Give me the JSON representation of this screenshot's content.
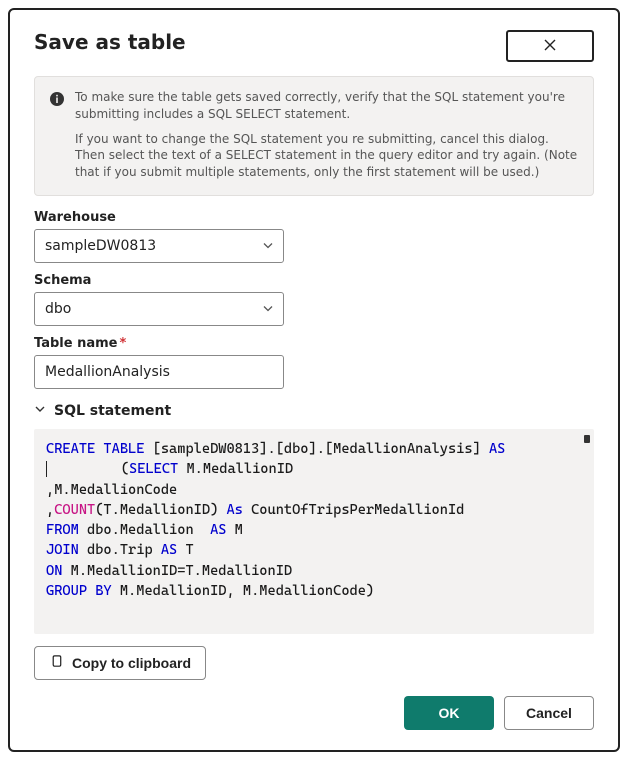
{
  "dialog": {
    "title": "Save as table",
    "info_line1": "To make sure the table gets saved correctly, verify that the SQL statement you're submitting includes a SQL SELECT statement.",
    "info_line2": "If you want to change the SQL statement you re submitting, cancel this dialog. Then select the text of a SELECT statement in the query editor and try again. (Note that if you submit multiple statements, only the first statement will be used.)"
  },
  "fields": {
    "warehouse_label": "Warehouse",
    "warehouse_value": "sampleDW0813",
    "schema_label": "Schema",
    "schema_value": "dbo",
    "tablename_label": "Table name",
    "tablename_value": "MedallionAnalysis"
  },
  "sql": {
    "header": "SQL statement",
    "tokens": {
      "create_table": "CREATE TABLE",
      "target": " [sampleDW0813].[dbo].[MedallionAnalysis] ",
      "as1": "AS",
      "indent_open": "         (",
      "select": "SELECT",
      "sel_col1": " M.MedallionID",
      "line2": ",M.MedallionCode",
      "comma3": ",",
      "count": "COUNT",
      "count_arg": "(T.MedallionID) ",
      "as2": "As",
      "alias": " CountOfTripsPerMedallionId",
      "from": "FROM",
      "from_body": " dbo.Medallion  ",
      "as3": "AS",
      "m": " M",
      "join": "JOIN",
      "join_body": " dbo.Trip ",
      "as4": "AS",
      "t": " T",
      "on": "ON",
      "on_body": " M.MedallionID=T.MedallionID",
      "group": "GROUP BY",
      "group_body": " M.MedallionID, M.MedallionCode)"
    }
  },
  "buttons": {
    "copy": "Copy to clipboard",
    "ok": "OK",
    "cancel": "Cancel"
  }
}
